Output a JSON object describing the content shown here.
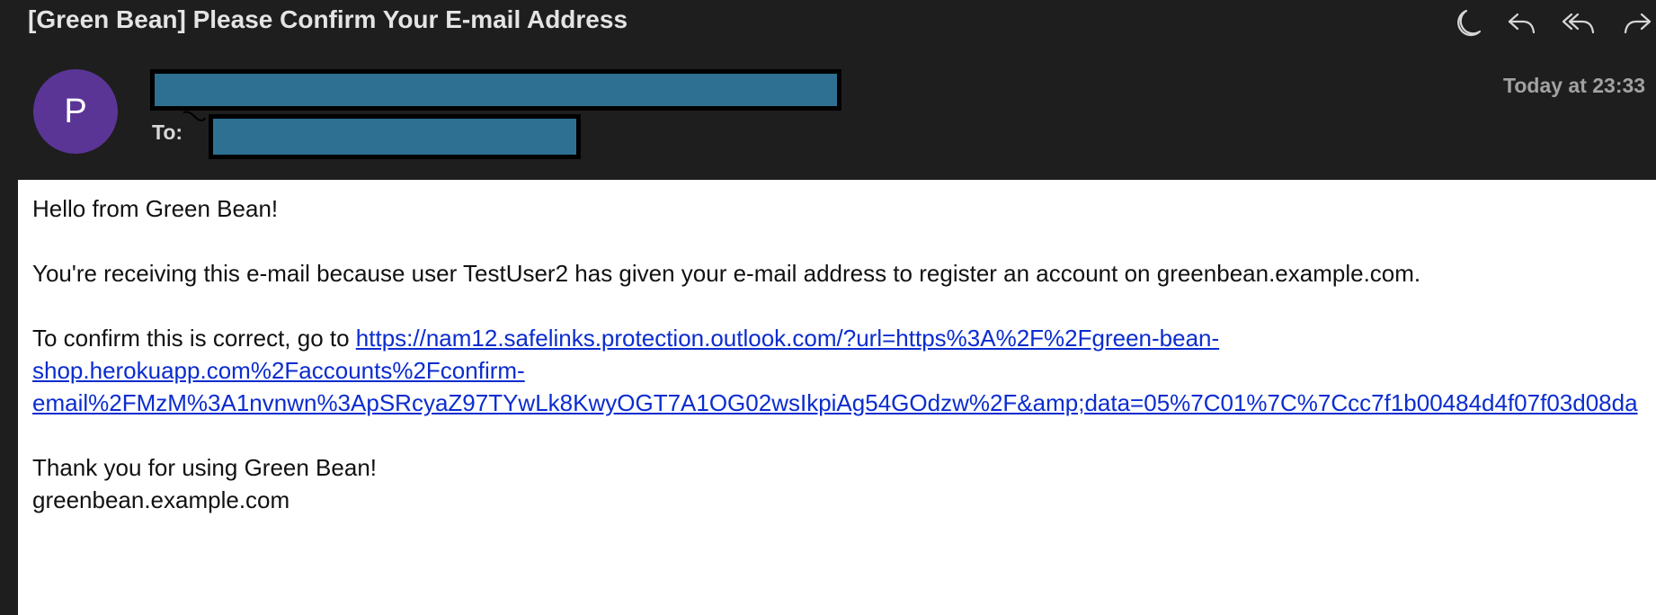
{
  "email": {
    "subject": "[Green Bean] Please Confirm Your E-mail Address",
    "sender_initial": "P",
    "to_label": "To:",
    "date": "Today at 23:33"
  },
  "toolbar": {
    "icons": [
      "moon-icon",
      "reply-icon",
      "reply-all-icon",
      "forward-icon"
    ]
  },
  "colors": {
    "window_bg": "#1e1e1e",
    "avatar_bg": "#5a3596",
    "redaction_fill": "#2e7092",
    "link": "#0b2ccf"
  },
  "message": {
    "greeting": "Hello from Green Bean!",
    "reason": "You're receiving this e-mail because user TestUser2 has given your e-mail address to register an account on greenbean.example.com.",
    "confirm_prefix": "To confirm this is correct, go to ",
    "confirm_link": {
      "line1": "https://nam12.safelinks.protection.outlook.com/?url=https%3A%2F%2Fgreen-bean-",
      "line2": "shop.herokuapp.com%2Faccounts%2Fconfirm-",
      "line3": "email%2FMzM%3A1nvnwn%3ApSRcyaZ97TYwLk8KwyOGT7A1OG02wsIkpiAg54GOdzw%2F&amp;data=05%7C01%7C%7Ccc7f1b00484d4f07f03d08da"
    },
    "thanks": "Thank you for using Green Bean!",
    "signature": "greenbean.example.com"
  }
}
